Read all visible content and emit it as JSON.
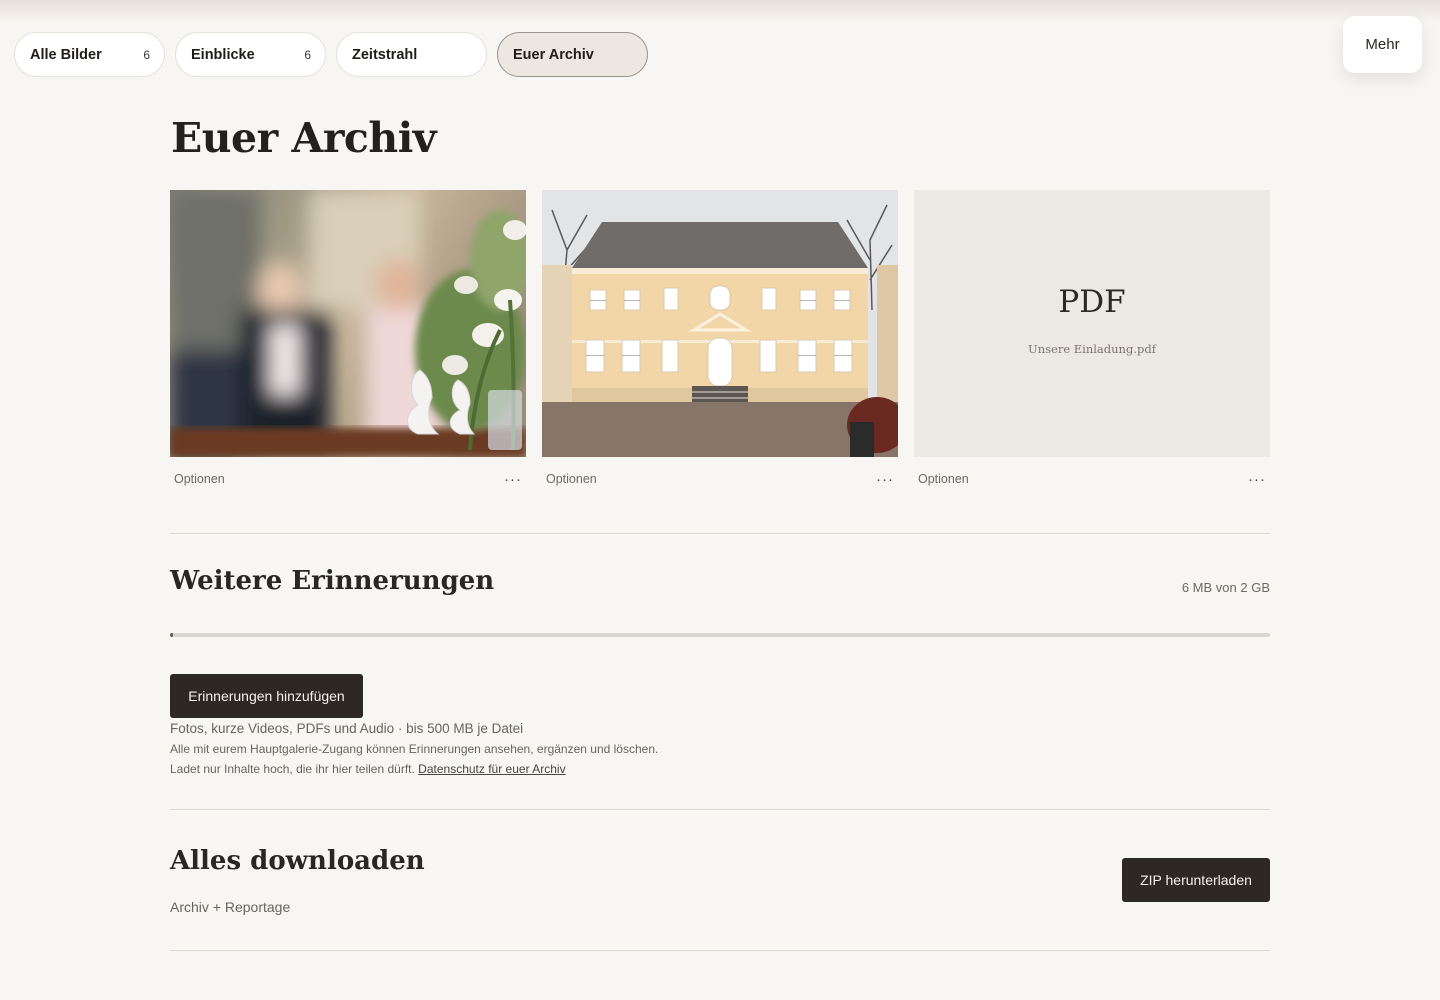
{
  "tabs": [
    {
      "label": "Alle Bilder",
      "count": "6"
    },
    {
      "label": "Einblicke",
      "count": "6"
    },
    {
      "label": "Zeitstrahl",
      "count": ""
    },
    {
      "label": "Euer Archiv",
      "count": ""
    }
  ],
  "more_label": "Mehr",
  "page_title": "Euer Archiv",
  "cards": [
    {
      "type": "photo",
      "subject": "wedding-couple-blurred",
      "options_label": "Optionen",
      "menu_icon": "ellipsis-icon"
    },
    {
      "type": "photo",
      "subject": "manor-house",
      "options_label": "Optionen",
      "menu_icon": "ellipsis-icon"
    },
    {
      "type": "pdf",
      "pdf_title": "PDF",
      "file_name": "Unsere Einladung.pdf",
      "options_label": "Optionen",
      "menu_icon": "ellipsis-icon"
    }
  ],
  "memories": {
    "heading": "Weitere Erinnerungen",
    "usage": "6 MB von 2 GB",
    "usage_fraction": 0.003,
    "add_button": "Erinnerungen hinzufügen",
    "formats": "Fotos, kurze Videos, PDFs und Audio · bis 500 MB je Datei",
    "access_note": "Alle mit eurem Hauptgalerie-Zugang können Erinnerungen ansehen, ergänzen und löschen.",
    "upload_note": "Ladet nur Inhalte hoch, die ihr hier teilen dürft.",
    "privacy_link": "Datenschutz für euer Archiv"
  },
  "download": {
    "heading": "Alles downloaden",
    "subtitle": "Archiv + Reportage",
    "zip_button": "ZIP herunterladen"
  },
  "colors": {
    "background": "#f7f6f3",
    "dark_button": "#2d2824",
    "active_tab": "#ece7e1"
  }
}
